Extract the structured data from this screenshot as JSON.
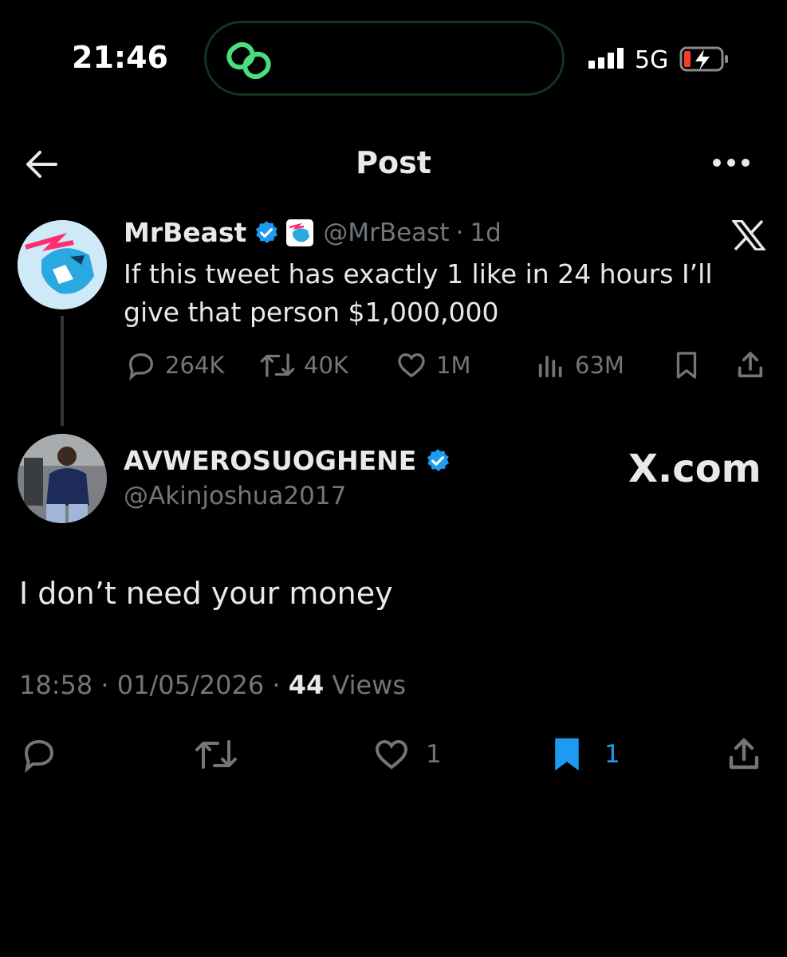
{
  "status": {
    "time": "21:46",
    "network": "5G"
  },
  "header": {
    "title": "Post"
  },
  "quoted": {
    "name": "MrBeast",
    "handle": "@MrBeast",
    "dot": "·",
    "age": "1d",
    "text": "If this tweet has exactly 1 like in 24 hours I’ll give that person $1,000,000",
    "replies": "264K",
    "reposts": "40K",
    "likes": "1M",
    "views": "63M"
  },
  "reply": {
    "name": "AVWEROSUOGHENE",
    "handle": "@Akinjoshua2017",
    "text": "I don’t need your money",
    "time": "18:58",
    "sep1": "·",
    "date": "01/05/2026",
    "sep2": "·",
    "views_count": "44",
    "views_label": " Views",
    "likes": "1",
    "bookmarks": "1"
  },
  "watermark": {
    "text": "X.com"
  },
  "colors": {
    "accent": "#1d9bf0",
    "muted": "#71767b",
    "text": "#e7e9ea",
    "background": "#000000"
  },
  "icons": [
    "back-arrow-icon",
    "more-icon",
    "verified-badge-icon",
    "x-logo-icon",
    "reply-icon",
    "repost-icon",
    "like-icon",
    "views-icon",
    "bookmark-icon",
    "share-icon",
    "signal-icon",
    "battery-charging-icon",
    "link-app-icon"
  ]
}
